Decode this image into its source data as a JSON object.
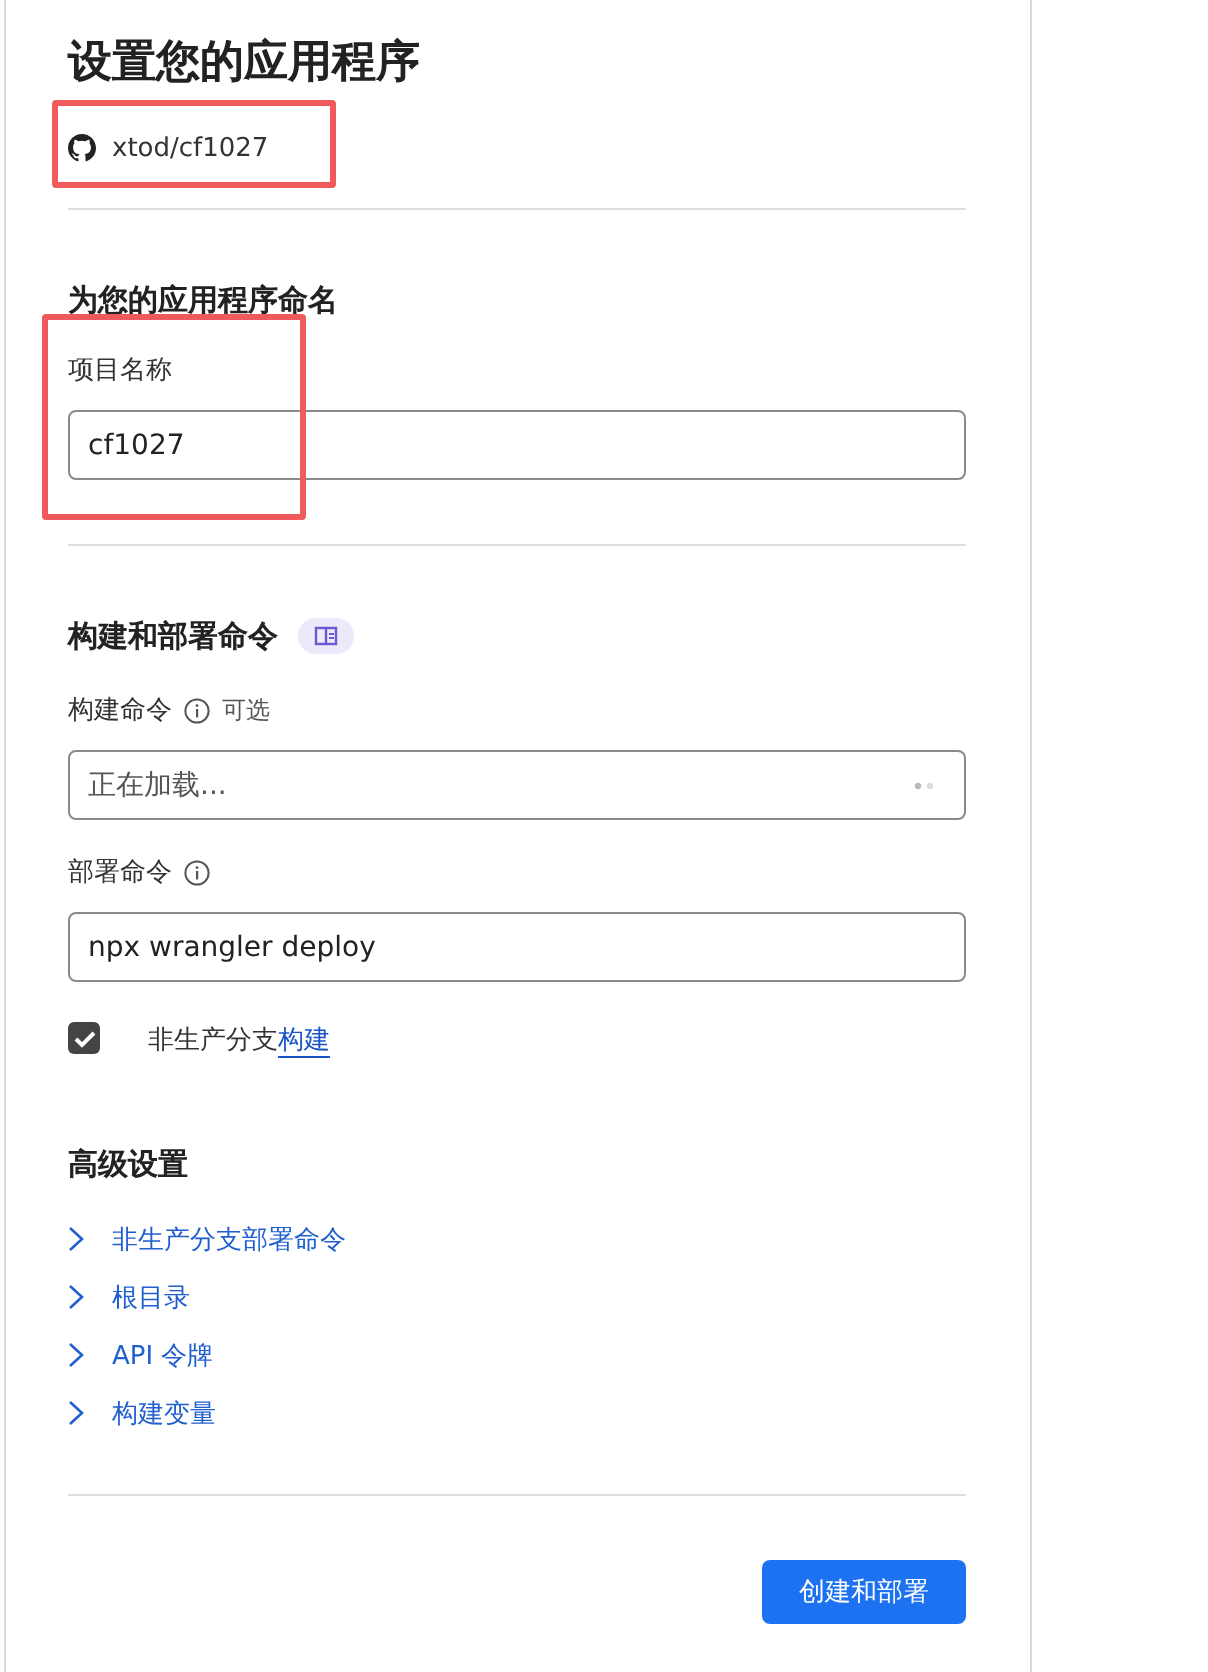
{
  "title": "设置您的应用程序",
  "repository": {
    "name": "xtod/cf1027",
    "highlighted": true
  },
  "naming": {
    "heading": "为您的应用程序命名",
    "field": {
      "label": "项目名称",
      "value": "cf1027",
      "highlighted": true
    }
  },
  "build": {
    "heading": "构建和部署命令",
    "fields": [
      {
        "label": "构建命令",
        "optional": "可选",
        "placeholder": "正在加载...",
        "loading": true
      },
      {
        "label": "部署命令",
        "value": "npx wrangler deploy"
      }
    ],
    "checkbox": {
      "label": "非生产分支",
      "link": "构建",
      "checked": true
    }
  },
  "advanced": {
    "heading": "高级设置",
    "items": [
      {
        "label": "非生产分支部署命令",
        "expanded": false
      },
      {
        "label": "根目录",
        "expanded": false
      },
      {
        "label": "API 令牌",
        "expanded": false
      },
      {
        "label": "构建变量",
        "expanded": false
      }
    ]
  },
  "submit": "创建和部署"
}
